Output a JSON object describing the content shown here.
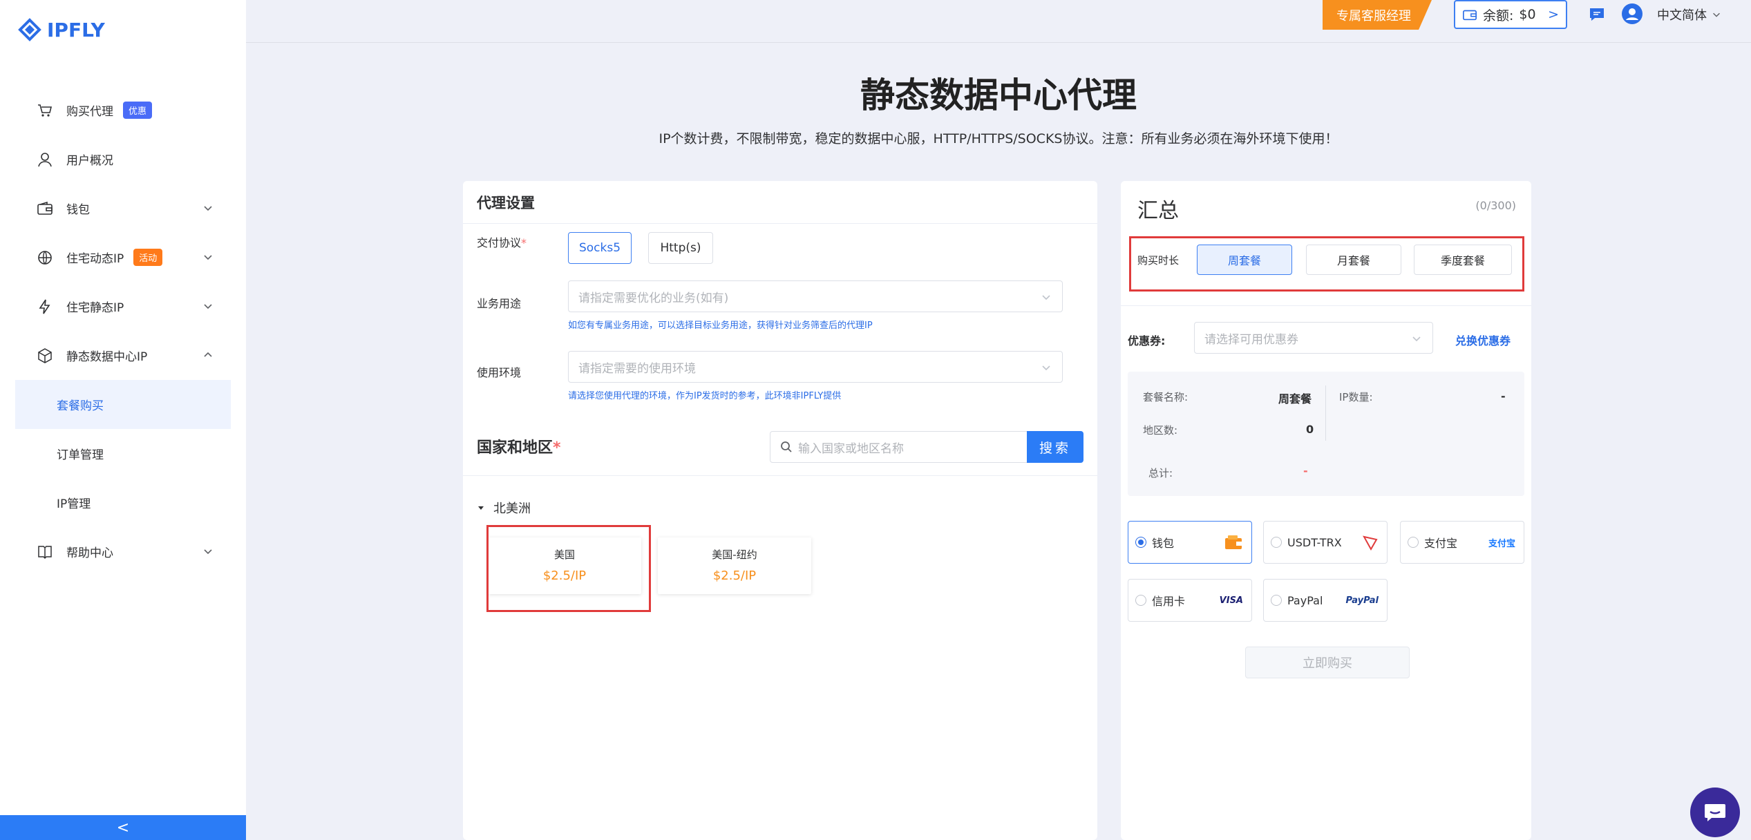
{
  "brand": {
    "name": "IPFLY"
  },
  "sidebar": {
    "items": [
      {
        "label": "购买代理",
        "badge": "优惠"
      },
      {
        "label": "用户概况"
      },
      {
        "label": "钱包"
      },
      {
        "label": "住宅动态IP",
        "badge": "活动"
      },
      {
        "label": "住宅静态IP"
      },
      {
        "label": "静态数据中心IP"
      }
    ],
    "sub_items": [
      "套餐购买",
      "订单管理",
      "IP管理"
    ],
    "help": "帮助中心",
    "collapse": "<"
  },
  "topbar": {
    "manager": "专属客服经理",
    "balance_label": "余额:",
    "balance_value": "$0",
    "balance_arrow": ">",
    "language": "中文简体"
  },
  "header": {
    "title": "静态数据中心代理",
    "subtitle": "IP个数计费，不限制带宽，稳定的数据中心服，HTTP/HTTPS/SOCKS协议。注意：所有业务必须在海外环境下使用！"
  },
  "proxy_settings": {
    "title": "代理设置",
    "protocol_label": "交付协议",
    "protocols": [
      "Socks5",
      "Http(s)"
    ],
    "business_label": "业务用途",
    "business_placeholder": "请指定需要优化的业务(如有)",
    "business_hint": "如您有专属业务用途，可以选择目标业务用途，获得针对业务筛查后的代理IP",
    "env_label": "使用环境",
    "env_placeholder": "请指定需要的使用环境",
    "env_hint": "请选择您使用代理的环境，作为IP发货时的参考，此环境非IPFLY提供",
    "country_title": "国家和地区",
    "search_placeholder": "输入国家或地区名称",
    "search_button": "搜索",
    "region": "北美洲",
    "countries": [
      {
        "name": "美国",
        "price": "$2.5/IP"
      },
      {
        "name": "美国-纽约",
        "price": "$2.5/IP"
      }
    ]
  },
  "summary": {
    "title": "汇总",
    "count": "(0/300)",
    "duration_label": "购买时长",
    "durations": [
      "周套餐",
      "月套餐",
      "季度套餐"
    ],
    "coupon_label": "优惠券:",
    "coupon_placeholder": "请选择可用优惠券",
    "coupon_link": "兑换优惠券",
    "package_label": "套餐名称:",
    "package_value": "周套餐",
    "ip_count_label": "IP数量:",
    "ip_count_value": "-",
    "region_count_label": "地区数:",
    "region_count_value": "0",
    "total_label": "总计:",
    "total_value": "-",
    "payments": [
      {
        "label": "钱包",
        "logo": "wallet-icon"
      },
      {
        "label": "USDT-TRX",
        "logo": "tron-icon"
      },
      {
        "label": "支付宝",
        "logo_text": "支付宝"
      },
      {
        "label": "信用卡",
        "logo_text": "VISA"
      },
      {
        "label": "PayPal",
        "logo_text": "PayPal"
      }
    ],
    "buy_button": "立即购买"
  },
  "colors": {
    "accent": "#2b7cf6",
    "orange": "#f7901e",
    "highlight": "#e03b3b"
  }
}
